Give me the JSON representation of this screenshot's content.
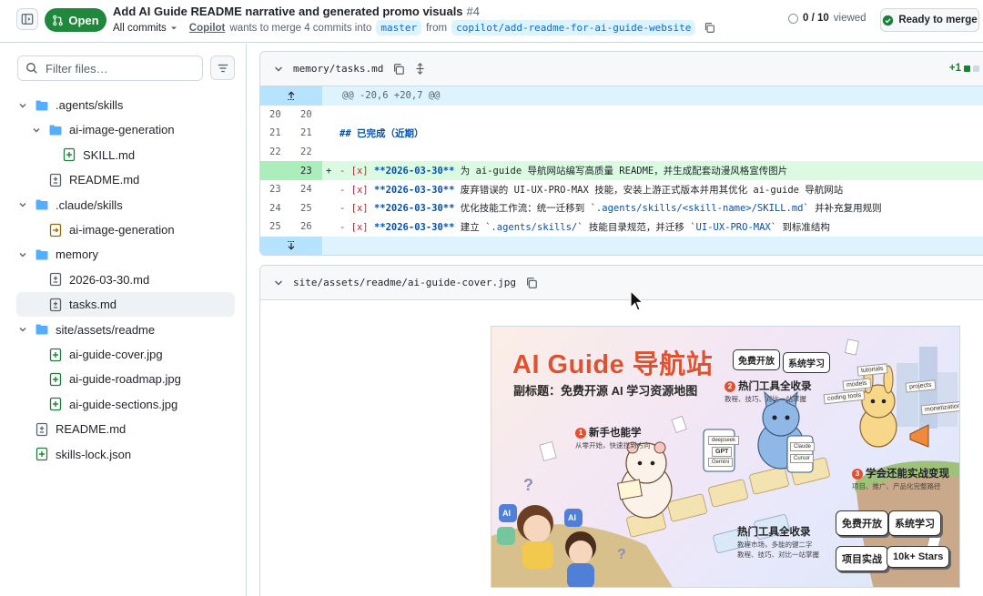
{
  "header": {
    "state": "Open",
    "title": "Add AI Guide README narrative and generated promo visuals",
    "number": "#4",
    "commits_menu": "All commits",
    "author": "Copilot",
    "merge_text": "wants to merge 4 commits into",
    "base_branch": "master",
    "from_text": "from",
    "head_branch": "copilot/add-readme-for-ai-guide-website",
    "viewed_count": "0 / 10",
    "viewed_label": "viewed",
    "ready_label": "Ready to merge"
  },
  "sidebar": {
    "filter_placeholder": "Filter files…",
    "items": [
      {
        "label": ".agents/skills",
        "type": "folder",
        "depth": 0,
        "expanded": true
      },
      {
        "label": "ai-image-generation",
        "type": "folder",
        "depth": 1,
        "expanded": true
      },
      {
        "label": "SKILL.md",
        "type": "file-added",
        "depth": 2
      },
      {
        "label": "README.md",
        "type": "file-modified",
        "depth": 1
      },
      {
        "label": ".claude/skills",
        "type": "folder",
        "depth": 0,
        "expanded": true
      },
      {
        "label": "ai-image-generation",
        "type": "file-renamed",
        "depth": 1
      },
      {
        "label": "memory",
        "type": "folder",
        "depth": 0,
        "expanded": true
      },
      {
        "label": "2026-03-30.md",
        "type": "file-modified",
        "depth": 1
      },
      {
        "label": "tasks.md",
        "type": "file-modified",
        "depth": 1,
        "selected": true
      },
      {
        "label": "site/assets/readme",
        "type": "folder",
        "depth": 0,
        "expanded": true
      },
      {
        "label": "ai-guide-cover.jpg",
        "type": "file-added",
        "depth": 1
      },
      {
        "label": "ai-guide-roadmap.jpg",
        "type": "file-added",
        "depth": 1
      },
      {
        "label": "ai-guide-sections.jpg",
        "type": "file-added",
        "depth": 1
      },
      {
        "label": "README.md",
        "type": "file-modified",
        "depth": 0
      },
      {
        "label": "skills-lock.json",
        "type": "file-added",
        "depth": 0
      }
    ]
  },
  "diff": {
    "file1": {
      "path": "memory/tasks.md",
      "stat": "+1",
      "hunk": "@@ -20,6 +20,7 @@",
      "lines": [
        {
          "old": "20",
          "new": "20",
          "text": ""
        },
        {
          "old": "21",
          "new": "21",
          "text": "## 已完成（近期）"
        },
        {
          "old": "22",
          "new": "22",
          "text": ""
        },
        {
          "old": "",
          "new": "23",
          "marker": "+",
          "prefix": "- [x] ",
          "date": "**2026-03-30**",
          "text": " 为 ai-guide 导航网站编写高质量 README，并生成配套动漫风格宣传图片"
        },
        {
          "old": "23",
          "new": "24",
          "prefix": "- [x] ",
          "date": "**2026-03-30**",
          "text": " 废弃错误的 UI-UX-PRO-MAX 技能，安装上游正式版本并用其优化 ai-guide 导航网站"
        },
        {
          "old": "24",
          "new": "25",
          "prefix": "- [x] ",
          "date": "**2026-03-30**",
          "text": " 优化技能工作流：统一迁移到 `",
          "code": ".agents/skills/<skill-name>/SKILL.md",
          "tail": "` 并补充复用规则"
        },
        {
          "old": "25",
          "new": "26",
          "prefix": "- [x] ",
          "date": "**2026-03-30**",
          "text": " 建立 `",
          "code": ".agents/skills/",
          "tail": "` 技能目录规范，并迁移 `",
          "code2": "UI-UX-PRO-MAX",
          "tail2": "` 到标准结构"
        }
      ]
    },
    "file2": {
      "path": "site/assets/readme/ai-guide-cover.jpg"
    }
  },
  "promo": {
    "title": "AI Guide 导航站",
    "subtitle": "副标题：免费开源 AI 学习资源地图",
    "tag_free": "免费开放",
    "tag_learn": "系统学习",
    "tag_practice": "项目实战",
    "tag_stars": "10k+ Stars",
    "callout1_num": "1",
    "callout1": "新手也能学",
    "callout1_sub": "从零开始，快速找到方向",
    "callout2_num": "2",
    "callout2": "热门工具全收录",
    "callout2_sub": "教程、技巧、对比一站掌握",
    "callout3_num": "3",
    "callout3": "学会还能实战变现",
    "callout3_sub": "项目、推广、产品化完整路径",
    "callout4": "热门工具全收录",
    "callout4_sub": "教程市场，多能的键二字\n教程、技巧、对比一站掌握",
    "tag_tutorials": "tutorials",
    "tag_models": "models",
    "tag_projects": "projects",
    "tag_coding": "coding tools",
    "tag_monet": "monetization",
    "tablet_deepseek": "deepseek",
    "tablet_gpt": "GPT",
    "tablet_gemini": "Gemini",
    "tablet_claude": "Claude",
    "tablet_cursor": "Cursor",
    "ai_badge": "AI"
  },
  "colors": {
    "open_green": "#1f883d",
    "add_green": "#1a7f37",
    "hunk_blue": "#ddf4ff",
    "add_bg": "#dafbe1"
  }
}
